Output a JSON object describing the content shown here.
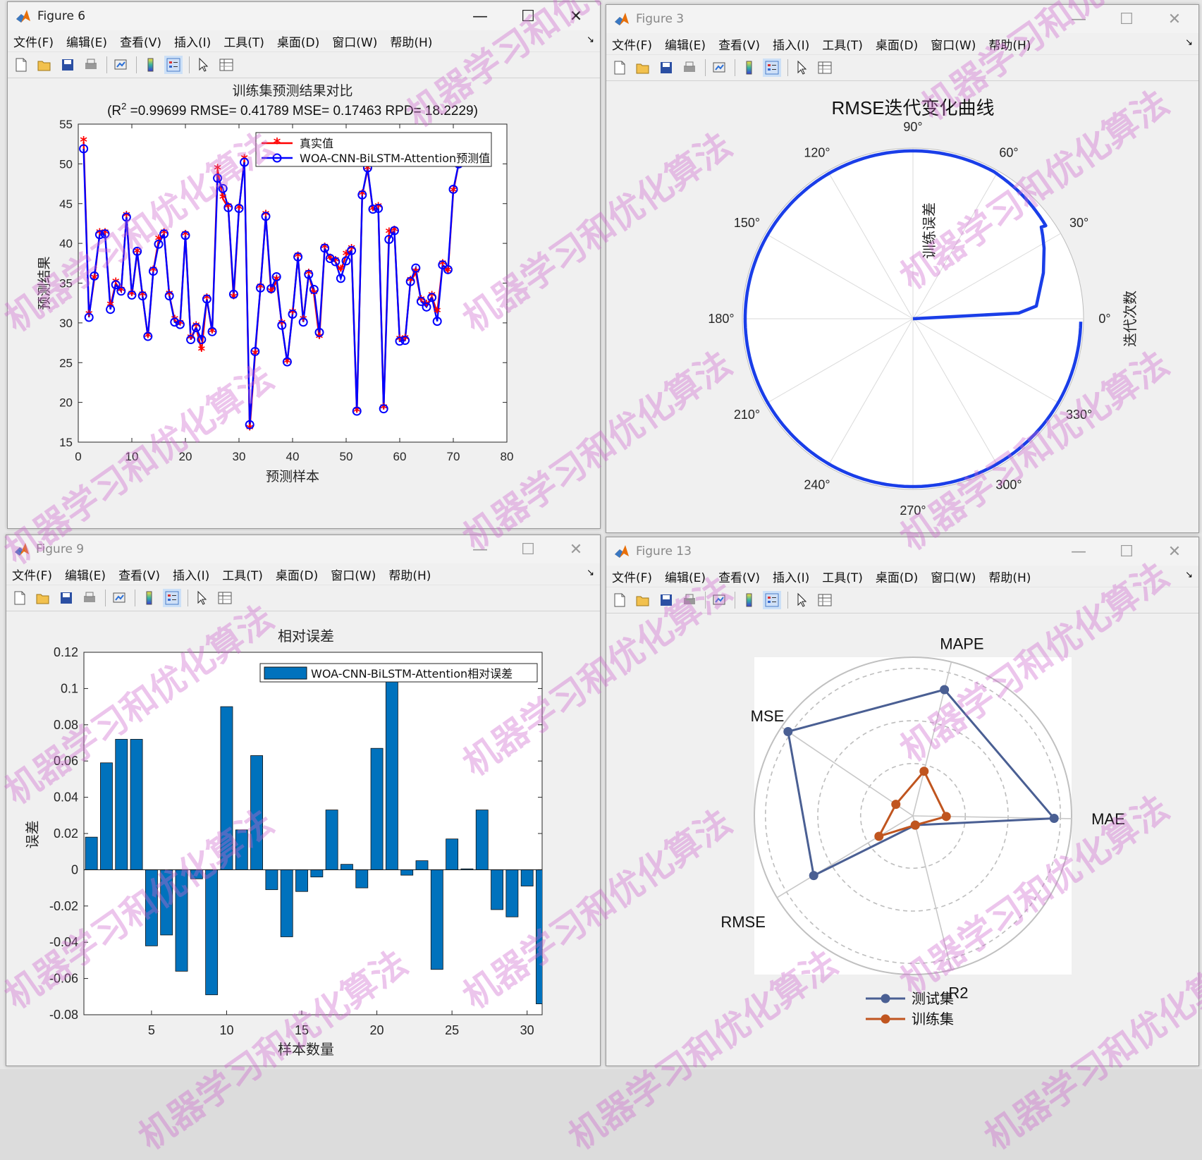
{
  "menu": [
    "文件(F)",
    "编辑(E)",
    "查看(V)",
    "插入(I)",
    "工具(T)",
    "桌面(D)",
    "窗口(W)",
    "帮助(H)"
  ],
  "toolbar_icons": [
    "new-figure-icon",
    "open-file-icon",
    "save-icon",
    "print-icon",
    "link-plot-icon",
    "colorbar-icon",
    "legend-icon",
    "pointer-icon",
    "property-inspector-icon"
  ],
  "watermark": "机器学习和优化算法",
  "windows": {
    "fig6": {
      "title": "Figure 6",
      "chart": {
        "title": "训练集预测结果对比",
        "subtitle_pre": "(R",
        "subtitle_sup": "2",
        "subtitle_post": " =0.99699 RMSE= 0.41789 MSE= 0.17463 RPD= 18.2229)",
        "xlabel": "预测样本",
        "ylabel": "预测结果",
        "legend_true": "真实值",
        "legend_pred": "WOA-CNN-BiLSTM-Attention预测值"
      }
    },
    "fig3": {
      "title": "Figure 3",
      "chart": {
        "title": "RMSE迭代变化曲线",
        "radial_label": "训练误差",
        "side_label": "迭代次数"
      }
    },
    "fig9": {
      "title": "Figure 9",
      "chart": {
        "title": "相对误差",
        "xlabel": "样本数量",
        "ylabel": "误差",
        "legend": "WOA-CNN-BiLSTM-Attention相对误差"
      }
    },
    "fig13": {
      "title": "Figure 13",
      "chart": {
        "legend_test": "测试集",
        "legend_train": "训练集"
      }
    }
  },
  "chart_data": [
    {
      "type": "line",
      "xlim": [
        0,
        80
      ],
      "ylim": [
        15,
        55
      ],
      "xticks": [
        0,
        10,
        20,
        30,
        40,
        50,
        60,
        70,
        80
      ],
      "yticks": [
        15,
        20,
        25,
        30,
        35,
        40,
        45,
        50,
        55
      ],
      "series": [
        {
          "name": "真实值",
          "color": "#ff0000",
          "marker": "star",
          "values": [
            52.8,
            30.9,
            35.5,
            41.2,
            41.2,
            32.1,
            35.0,
            34.0,
            43.4,
            33.5,
            38.8,
            33.4,
            28.2,
            36.5,
            40.4,
            41.2,
            33.5,
            30.3,
            29.8,
            41.0,
            28.0,
            29.5,
            26.5,
            33.0,
            28.8,
            49.3,
            45.6,
            44.5,
            33.1,
            44.3,
            50.5,
            16.6,
            26.0,
            34.4,
            43.5,
            33.8,
            35.3,
            29.8,
            25.0,
            31.2,
            38.3,
            30.3,
            36.1,
            33.6,
            28.1,
            39.4,
            38.0,
            37.7,
            36.6,
            38.5,
            39.2,
            18.8,
            46.1,
            49.3,
            44.2,
            44.5,
            19.2,
            41.3,
            41.5,
            27.8,
            27.9,
            35.2,
            36.3,
            32.8,
            32.2,
            33.3,
            31.3,
            37.3,
            36.4,
            46.5,
            50.0
          ]
        },
        {
          "name": "WOA-CNN-BiLSTM-Attention预测值",
          "color": "#0000ff",
          "marker": "circle",
          "values": [
            51.9,
            30.7,
            35.9,
            41.1,
            41.2,
            31.7,
            34.8,
            34.0,
            43.3,
            33.5,
            39.0,
            33.4,
            28.3,
            36.5,
            39.9,
            41.2,
            33.4,
            30.1,
            29.8,
            41.0,
            27.9,
            29.4,
            27.9,
            33.0,
            28.9,
            48.2,
            46.9,
            44.5,
            33.6,
            44.4,
            50.2,
            17.2,
            26.4,
            34.4,
            43.4,
            34.3,
            35.8,
            29.7,
            25.1,
            31.1,
            38.3,
            30.1,
            36.1,
            34.2,
            28.8,
            39.4,
            38.1,
            37.7,
            35.6,
            37.8,
            39.1,
            18.9,
            46.1,
            49.5,
            44.3,
            44.4,
            19.2,
            40.5,
            41.6,
            27.7,
            27.8,
            35.2,
            36.9,
            32.7,
            32.0,
            33.2,
            30.2,
            37.3,
            36.7,
            46.8,
            50.0
          ]
        }
      ]
    },
    {
      "type": "polar-line",
      "angle_ticks": [
        "0°",
        "30°",
        "60°",
        "90°",
        "120°",
        "150°",
        "180°",
        "210°",
        "240°",
        "270°",
        "300°",
        "330°"
      ],
      "series": [
        {
          "name": "RMSE",
          "color": "#1a3ee8"
        }
      ]
    },
    {
      "type": "bar",
      "xlim": [
        0.5,
        31
      ],
      "ylim": [
        -0.08,
        0.12
      ],
      "xticks": [
        5,
        10,
        15,
        20,
        25,
        30
      ],
      "yticks": [
        -0.08,
        -0.06,
        -0.04,
        -0.02,
        0,
        0.02,
        0.04,
        0.06,
        0.08,
        0.1,
        0.12
      ],
      "series": [
        {
          "name": "WOA-CNN-BiLSTM-Attention相对误差",
          "color": "#0072bd",
          "values": [
            0.018,
            0.059,
            0.072,
            0.072,
            -0.042,
            -0.036,
            -0.056,
            -0.005,
            -0.069,
            0.09,
            0.022,
            0.063,
            -0.011,
            -0.037,
            -0.012,
            -0.004,
            0.033,
            0.003,
            -0.01,
            0.067,
            0.105,
            -0.003,
            0.005,
            -0.055,
            0.017,
            0.0005,
            0.033,
            -0.022,
            -0.026,
            -0.009,
            -0.074
          ]
        }
      ]
    },
    {
      "type": "radar",
      "axes": [
        "MAPE",
        "MAE",
        "R2",
        "RMSE",
        "MSE"
      ],
      "series": [
        {
          "name": "测试集",
          "color": "#4a5f93",
          "values": [
            0.82,
            0.89,
            0.06,
            0.73,
            0.95
          ]
        },
        {
          "name": "训练集",
          "color": "#c0551f",
          "values": [
            0.29,
            0.21,
            0.06,
            0.25,
            0.13
          ]
        }
      ]
    }
  ]
}
